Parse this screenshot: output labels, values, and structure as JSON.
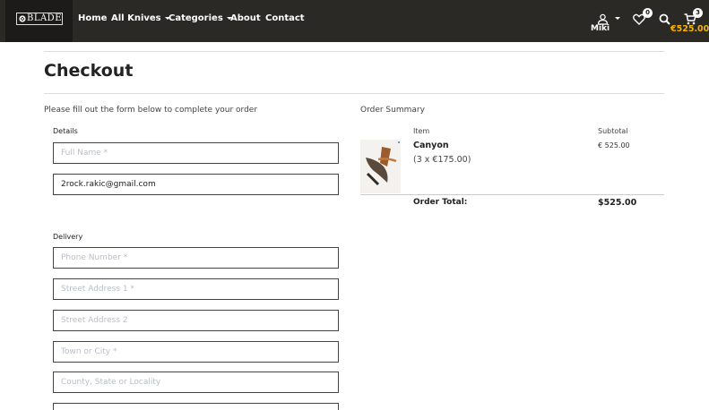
{
  "brand": {
    "logo_text": "BLADE"
  },
  "nav": {
    "home": "Home",
    "all_knives": "All Knives",
    "categories": "Categories",
    "about": "About",
    "contact": "Contact"
  },
  "header_icons": {
    "account_name": "Miki",
    "wishlist_count": "0",
    "cart_count": "3",
    "cart_total": "€525.00",
    "cart_total_color": "#f5b400"
  },
  "page": {
    "title": "Checkout"
  },
  "form": {
    "instructions": "Please fill out the form below to complete your order",
    "details_label": "Details",
    "full_name_placeholder": "Full Name *",
    "email_value": "2rock.rakic@gmail.com",
    "delivery_label": "Delivery",
    "phone_placeholder": "Phone Number *",
    "street1_placeholder": "Street Address 1 *",
    "street2_placeholder": "Street Address 2",
    "town_placeholder": "Town or City *",
    "county_placeholder": "County, State or Locality"
  },
  "summary": {
    "title": "Order Summary",
    "col_item": "Item",
    "col_subtotal": "Subtotal",
    "items": [
      {
        "name": "Canyon",
        "qty_price": "(3 x €175.00)",
        "subtotal": "€ 525.00"
      }
    ],
    "total_label": "Order Total:",
    "total_value": "$525.00"
  }
}
